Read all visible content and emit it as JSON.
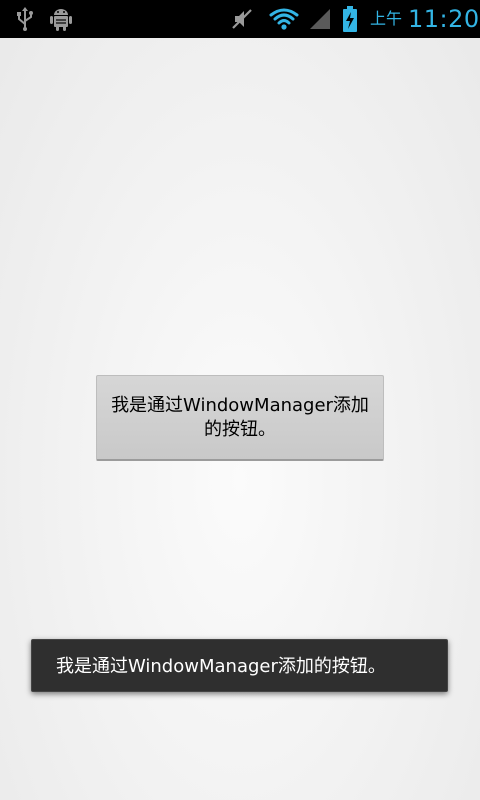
{
  "status_bar": {
    "time_prefix": "上午",
    "time": "11:20",
    "icons": [
      "usb-icon",
      "android-debug-icon",
      "mute-icon",
      "wifi-icon",
      "signal-icon",
      "battery-charging-icon"
    ],
    "accent_color": "#33b5e5"
  },
  "main": {
    "button_label": "我是通过WindowManager添加的按钮。"
  },
  "toast": {
    "message": "我是通过WindowManager添加的按钮。"
  }
}
